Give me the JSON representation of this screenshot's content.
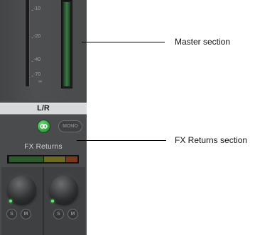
{
  "master": {
    "db_scale": [
      "-10",
      "-20",
      "-40",
      "-70",
      "∞"
    ],
    "meter_level": 1.0,
    "output_label": "L/R",
    "link_button": {
      "icon": "link-icon",
      "color": "#3fbf4a",
      "active": true
    },
    "mono_label": "MONO"
  },
  "fx_returns": {
    "title": "FX Returns",
    "meter_colors": [
      "#2d5a2a",
      "#6b6a22",
      "#7a3a1a"
    ],
    "knobs": [
      {
        "solo_label": "S",
        "mute_label": "M"
      },
      {
        "solo_label": "S",
        "mute_label": "M"
      }
    ]
  },
  "callouts": {
    "master": "Master section",
    "fx_returns": "FX Returns section"
  }
}
